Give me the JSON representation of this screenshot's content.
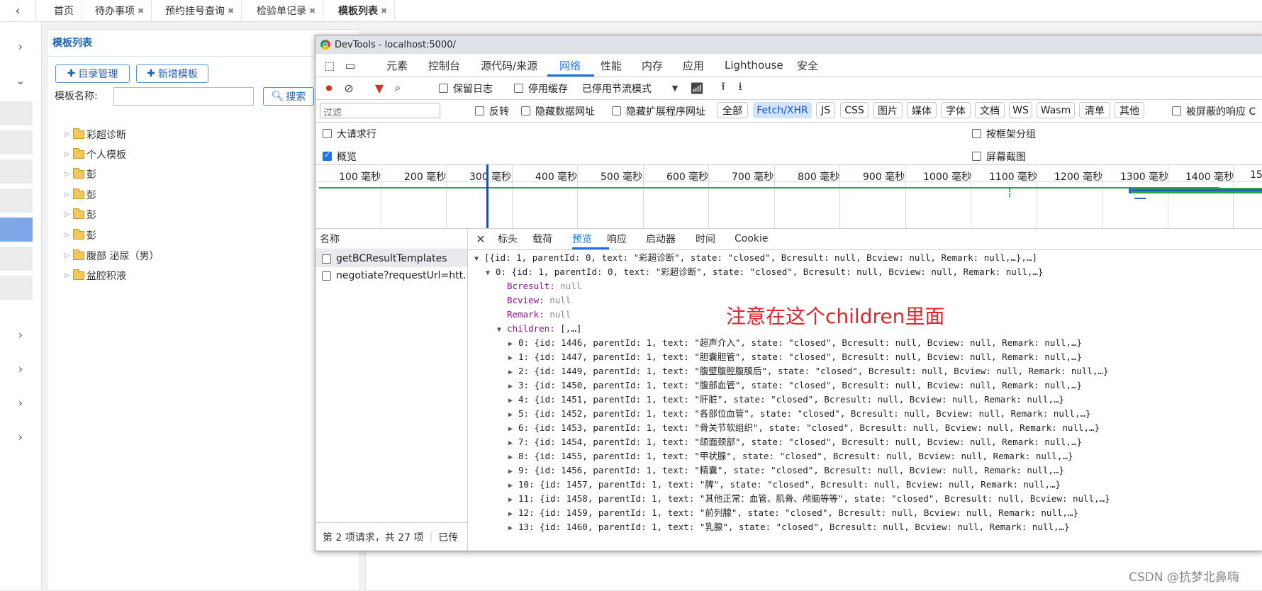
{
  "tabs": [
    "首页",
    "待办事项",
    "预约挂号查询",
    "检验单记录",
    "模板列表"
  ],
  "panel": {
    "title": "模板列表",
    "dir_button": "目录管理",
    "new_button": "新增模板",
    "name_label": "模板名称:",
    "name_value": "",
    "search_button": "搜索"
  },
  "tree": [
    "彩超诊断",
    "个人模板",
    "彭",
    "彭",
    "彭",
    "彭",
    "腹部 泌尿（男）",
    "盆腔积液"
  ],
  "devtools": {
    "window_title": "DevTools - localhost:5000/",
    "main_tabs": [
      "元素",
      "控制台",
      "源代码/来源",
      "网络",
      "性能",
      "内存",
      "应用",
      "Lighthouse",
      "安全"
    ],
    "toolbar": {
      "preserve_log": "保留日志",
      "disable_cache": "停用缓存",
      "throttling": "已停用节流模式"
    },
    "filter": {
      "placeholder": "过滤",
      "invert": "反转",
      "hide_data_urls": "隐藏数据网址",
      "hide_ext_urls": "隐藏扩展程序网址",
      "types": [
        "全部",
        "Fetch/XHR",
        "JS",
        "CSS",
        "图片",
        "媒体",
        "字体",
        "文档",
        "WS",
        "Wasm",
        "清单",
        "其他"
      ],
      "blocked": "被屏蔽的响应 C"
    },
    "options": {
      "big_rows": "大请求行",
      "overview": "概览",
      "group_by_frame": "按框架分组",
      "screenshots": "屏幕截图"
    },
    "timeline_ticks": [
      "100 毫秒",
      "200 毫秒",
      "300 毫秒",
      "400 毫秒",
      "500 毫秒",
      "600 毫秒",
      "700 毫秒",
      "800 毫秒",
      "900 毫秒",
      "1000 毫秒",
      "1100 毫秒",
      "1200 毫秒",
      "1300 毫秒",
      "1400 毫秒",
      "15"
    ],
    "names_header": "名称",
    "requests": [
      "getBCResultTemplates",
      "negotiate?requestUrl=htt..."
    ],
    "footer": "第 2 项请求，共 27 项",
    "footer_extra": "已传",
    "detail_tabs": [
      "标头",
      "载荷",
      "预览",
      "响应",
      "启动器",
      "时间",
      "Cookie"
    ],
    "preview": {
      "root": "[{id: 1, parentId: 0, text: \"彩超诊断\", state: \"closed\", Bcresult: null, Bcview: null, Remark: null,…},…]",
      "item0": "0: {id: 1, parentId: 0, text: \"彩超诊断\", state: \"closed\", Bcresult: null, Bcview: null, Remark: null,…}",
      "fields": [
        {
          "key": "Bcresult",
          "value": "null"
        },
        {
          "key": "Bcview",
          "value": "null"
        },
        {
          "key": "Remark",
          "value": "null"
        }
      ],
      "children_key": "children",
      "children_value": "[,…]",
      "children": [
        "0: {id: 1446, parentId: 1, text: \"超声介入\", state: \"closed\", Bcresult: null, Bcview: null, Remark: null,…}",
        "1: {id: 1447, parentId: 1, text: \"胆囊胆管\", state: \"closed\", Bcresult: null, Bcview: null, Remark: null,…}",
        "2: {id: 1449, parentId: 1, text: \"腹壁腹腔腹膜后\", state: \"closed\", Bcresult: null, Bcview: null, Remark: null,…}",
        "3: {id: 1450, parentId: 1, text: \"腹部血管\", state: \"closed\", Bcresult: null, Bcview: null, Remark: null,…}",
        "4: {id: 1451, parentId: 1, text: \"肝脏\", state: \"closed\", Bcresult: null, Bcview: null, Remark: null,…}",
        "5: {id: 1452, parentId: 1, text: \"各部位血管\", state: \"closed\", Bcresult: null, Bcview: null, Remark: null,…}",
        "6: {id: 1453, parentId: 1, text: \"骨关节软组织\", state: \"closed\", Bcresult: null, Bcview: null, Remark: null,…}",
        "7: {id: 1454, parentId: 1, text: \"颌面颈部\", state: \"closed\", Bcresult: null, Bcview: null, Remark: null,…}",
        "8: {id: 1455, parentId: 1, text: \"甲状腺\", state: \"closed\", Bcresult: null, Bcview: null, Remark: null,…}",
        "9: {id: 1456, parentId: 1, text: \"精囊\", state: \"closed\", Bcresult: null, Bcview: null, Remark: null,…}",
        "10: {id: 1457, parentId: 1, text: \"脾\", state: \"closed\", Bcresult: null, Bcview: null, Remark: null,…}",
        "11: {id: 1458, parentId: 1, text: \"其他正常：血管、肌骨、颅脑等等\", state: \"closed\", Bcresult: null, Bcview: null,…}",
        "12: {id: 1459, parentId: 1, text: \"前列腺\", state: \"closed\", Bcresult: null, Bcview: null, Remark: null,…}",
        "13: {id: 1460, parentId: 1, text: \"乳腺\", state: \"closed\", Bcresult: null, Bcview: null, Remark: null,…}"
      ]
    },
    "annotation": "注意在这个children里面"
  },
  "watermark": "CSDN @抗梦北鼻嗨",
  "colors": {
    "accent": "#1a73e8",
    "panel_title": "#1e63b8",
    "annotation": "#e5232b"
  }
}
